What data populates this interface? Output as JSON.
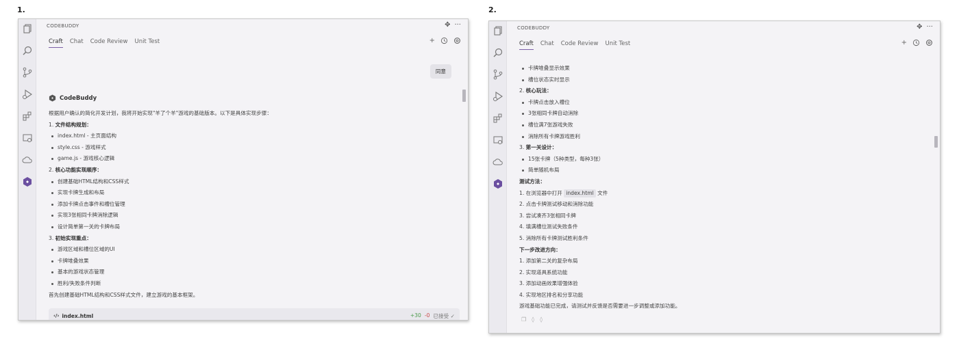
{
  "figure_labels": [
    "1.",
    "2."
  ],
  "panels": [
    {
      "header": {
        "title": "CODEBUDDY",
        "move_icon": "move-icon",
        "more_icon": "more-icon"
      },
      "tabs": [
        {
          "label": "Craft",
          "active": true
        },
        {
          "label": "Chat",
          "active": false
        },
        {
          "label": "Code Review",
          "active": false
        },
        {
          "label": "Unit Test",
          "active": false
        }
      ],
      "user_message": "同意",
      "assistant_name": "CodeBuddy",
      "lines": [
        {
          "kind": "text",
          "text": "根据用户确认的简化开发计划，我将开始实现\"羊了个羊\"游戏的基础版本。以下是具体实现步骤："
        },
        {
          "kind": "heading",
          "num": "1. ",
          "text": "文件结构规划："
        },
        {
          "kind": "bullet",
          "text": "index.html - 主页面结构"
        },
        {
          "kind": "bullet",
          "text": "style.css - 游戏样式"
        },
        {
          "kind": "bullet",
          "text": "game.js - 游戏核心逻辑"
        },
        {
          "kind": "heading",
          "num": "2. ",
          "text": "核心功能实现顺序："
        },
        {
          "kind": "bullet",
          "text": "创建基础HTML结构和CSS样式"
        },
        {
          "kind": "bullet",
          "text": "实现卡牌生成和布局"
        },
        {
          "kind": "bullet",
          "text": "添加卡牌点击事件和槽位管理"
        },
        {
          "kind": "bullet",
          "text": "实现3张相同卡牌消除逻辑"
        },
        {
          "kind": "bullet",
          "text": "设计简单第一关的卡牌布局"
        },
        {
          "kind": "heading",
          "num": "3. ",
          "text": "初始实现重点："
        },
        {
          "kind": "bullet",
          "text": "游戏区域和槽位区域的UI"
        },
        {
          "kind": "bullet",
          "text": "卡牌堆叠效果"
        },
        {
          "kind": "bullet",
          "text": "基本的游戏状态管理"
        },
        {
          "kind": "bullet",
          "text": "胜利/失败条件判断"
        },
        {
          "kind": "text",
          "text": "首先创建基础HTML结构和CSS样式文件，建立游戏的基本框架。"
        }
      ],
      "file_bar": {
        "filename": "index.html",
        "added": "+30",
        "removed": "-0",
        "status": "已接受"
      }
    },
    {
      "header": {
        "title": "CODEBUDDY",
        "move_icon": "move-icon",
        "more_icon": "more-icon"
      },
      "tabs": [
        {
          "label": "Craft",
          "active": true
        },
        {
          "label": "Chat",
          "active": false
        },
        {
          "label": "Code Review",
          "active": false
        },
        {
          "label": "Unit Test",
          "active": false
        }
      ],
      "lines": [
        {
          "kind": "bullet",
          "text": "卡牌堆叠显示效果"
        },
        {
          "kind": "bullet",
          "text": "槽位状态实时显示"
        },
        {
          "kind": "heading",
          "num": "2. ",
          "text": "核心玩法："
        },
        {
          "kind": "bullet",
          "text": "卡牌点击放入槽位"
        },
        {
          "kind": "bullet",
          "text": "3张相同卡牌自动消除"
        },
        {
          "kind": "bullet",
          "text": "槽位满7张游戏失败"
        },
        {
          "kind": "bullet",
          "text": "消除所有卡牌游戏胜利"
        },
        {
          "kind": "heading",
          "num": "3. ",
          "text": "第一关设计："
        },
        {
          "kind": "bullet",
          "text": "15张卡牌（5种类型，每种3张）"
        },
        {
          "kind": "bullet",
          "text": "简单随机布局"
        },
        {
          "kind": "heading",
          "num": "",
          "text": "测试方法："
        },
        {
          "kind": "code",
          "before": "1. 在浏览器中打开 ",
          "code": "index.html",
          "after": " 文件"
        },
        {
          "kind": "text",
          "text": "2. 点击卡牌测试移动和消除功能"
        },
        {
          "kind": "text",
          "text": "3. 尝试凑齐3张相同卡牌"
        },
        {
          "kind": "text",
          "text": "4. 填满槽位测试失败条件"
        },
        {
          "kind": "text",
          "text": "5. 消除所有卡牌测试胜利条件"
        },
        {
          "kind": "heading",
          "num": "",
          "text": "下一步改进方向："
        },
        {
          "kind": "text",
          "text": "1. 添加第二关的复杂布局"
        },
        {
          "kind": "text",
          "text": "2. 实现道具系统功能"
        },
        {
          "kind": "text",
          "text": "3. 添加动画效果增强体验"
        },
        {
          "kind": "text",
          "text": "4. 实现地区排名和分享功能"
        },
        {
          "kind": "text",
          "text": "游戏基础功能已完成，请测试并反馈是否需要进一步调整或添加功能。"
        }
      ]
    }
  ],
  "activity_icons": [
    "explorer-icon",
    "search-icon",
    "source-control-icon",
    "run-debug-icon",
    "extensions-icon",
    "remote-explorer-icon",
    "cloud-icon",
    "codebuddy-logo-icon"
  ],
  "colors": {
    "accent": "#7b5ea7",
    "added": "#4a9a4a",
    "removed": "#c94848"
  }
}
